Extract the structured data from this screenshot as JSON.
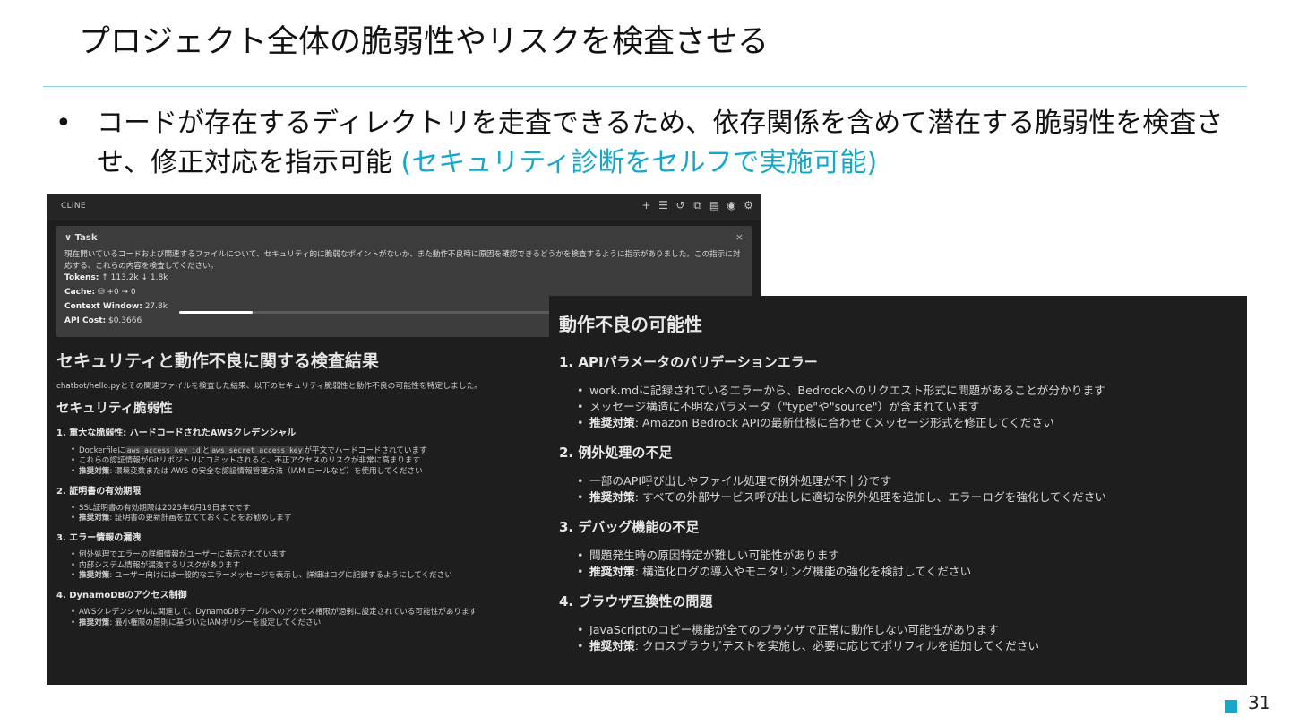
{
  "slide": {
    "title": "プロジェクト全体の脆弱性やリスクを検査させる",
    "bullet_marker": "•",
    "bullet_main": "コードが存在するディレクトリを走査できるため、依存関係を含めて潜在する脆弱性を検査させ、修正対応を指示可能",
    "bullet_accent": "(セキュリティ診断をセルフで実施可能)",
    "page_number": "31",
    "accent_color": "#18a7c9"
  },
  "cline": {
    "title": "CLINE",
    "toolbar_icons": [
      "plus-icon",
      "list-icon",
      "history-icon",
      "external-link-icon",
      "account-icon",
      "user-circle-icon",
      "gear-icon"
    ],
    "task": {
      "chevron": "∨",
      "label": "Task",
      "close": "×",
      "description": "現在開いているコードおよび関連するファイルについて、セキュリティ的に脆弱なポイントがないか、また動作不良時に原因を確認できるどうかを検査するように指示がありました。この指示に対応する、これらの内容を検査してください。",
      "tokens_label": "Tokens:",
      "tokens_value": "↑ 113.2k ↓ 1.8k",
      "cache_label": "Cache:",
      "cache_value": "⛁ +0 → 0",
      "context_label": "Context Window:",
      "context_value": "27.8k",
      "context_fill": 0.13,
      "cost_label": "API Cost:",
      "cost_value": "$0.3666"
    },
    "report": {
      "h1": "セキュリティと動作不良に関する検査結果",
      "intro": "chatbot/hello.pyとその関連ファイルを検査した結果、以下のセキュリティ脆弱性と動作不良の可能性を特定しました。",
      "h2": "セキュリティ脆弱性",
      "s1_title": "1. 重大な脆弱性: ハードコードされたAWSクレデンシャル",
      "s1_b1_pre": "Dockerfileに",
      "s1_b1_code1": "aws_access_key_id",
      "s1_b1_mid": "と",
      "s1_b1_code2": "aws_secret_access_key",
      "s1_b1_post": "が平文でハードコードされています",
      "s1_b2": "これらの認証情報がGitリポジトリにコミットされると、不正アクセスのリスクが非常に高まります",
      "s1_b3_label": "推奨対策",
      "s1_b3_text": ": 環境変数または AWS の安全な認証情報管理方法（IAM ロールなど）を使用してください",
      "s2_title": "2. 証明書の有効期限",
      "s2_b1": "SSL証明書の有効期限は2025年6月19日までです",
      "s2_b2_label": "推奨対策",
      "s2_b2_text": ": 証明書の更新計画を立てておくことをお勧めします",
      "s3_title": "3. エラー情報の漏洩",
      "s3_b1": "例外処理でエラーの詳細情報がユーザーに表示されています",
      "s3_b2": "内部システム情報が漏洩するリスクがあります",
      "s3_b3_label": "推奨対策",
      "s3_b3_text": ": ユーザー向けには一般的なエラーメッセージを表示し、詳細はログに記録するようにしてください",
      "s4_title": "4. DynamoDBのアクセス制御",
      "s4_b1": "AWSクレデンシャルに関連して、DynamoDBテーブルへのアクセス権限が過剰に設定されている可能性があります",
      "s4_b2_label": "推奨対策",
      "s4_b2_text": ": 最小権限の原則に基づいたIAMポリシーを設定してください"
    }
  },
  "overlay": {
    "h2": "動作不良の可能性",
    "s1_title": "1. APIパラメータのバリデーションエラー",
    "s1_b1": "work.mdに記録されているエラーから、Bedrockへのリクエスト形式に問題があることが分かります",
    "s1_b2": "メッセージ構造に不明なパラメータ（\"type\"や\"source\"）が含まれています",
    "s1_b3_label": "推奨対策",
    "s1_b3_text": ": Amazon Bedrock APIの最新仕様に合わせてメッセージ形式を修正してください",
    "s2_title": "2. 例外処理の不足",
    "s2_b1": "一部のAPI呼び出しやファイル処理で例外処理が不十分です",
    "s2_b2_label": "推奨対策",
    "s2_b2_text": ": すべての外部サービス呼び出しに適切な例外処理を追加し、エラーログを強化してください",
    "s3_title": "3. デバッグ機能の不足",
    "s3_b1": "問題発生時の原因特定が難しい可能性があります",
    "s3_b2_label": "推奨対策",
    "s3_b2_text": ": 構造化ログの導入やモニタリング機能の強化を検討してください",
    "s4_title": "4. ブラウザ互換性の問題",
    "s4_b1": "JavaScriptのコピー機能が全てのブラウザで正常に動作しない可能性があります",
    "s4_b2_label": "推奨対策",
    "s4_b2_text": ": クロスブラウザテストを実施し、必要に応じてポリフィルを追加してください"
  }
}
